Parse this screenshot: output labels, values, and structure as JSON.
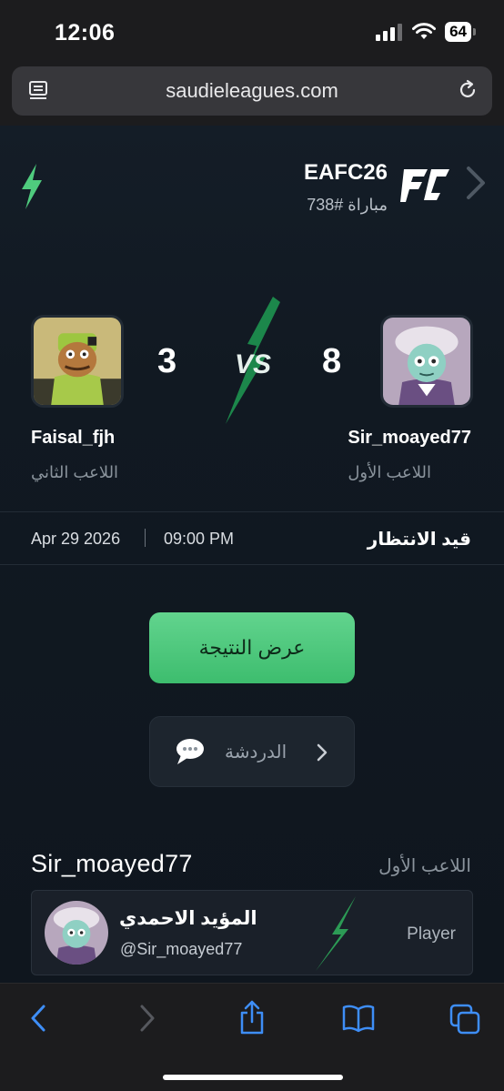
{
  "status_bar": {
    "time": "12:06",
    "battery": "64"
  },
  "browser": {
    "url": "saudieleagues.com"
  },
  "match": {
    "game": "EAFC26",
    "match_label": "مباراة #738",
    "player_one": {
      "name": "Sir_moayed77",
      "role": "اللاعب الأول",
      "score": "8"
    },
    "player_two": {
      "name": "Faisal_fjh",
      "role": "اللاعب الثاني",
      "score": "3"
    },
    "vs_label": "VS",
    "date": "Apr 29 2026",
    "time": "09:00 PM",
    "status": "قيد الانتظار"
  },
  "actions": {
    "view_result": "عرض النتيجة",
    "chat": "الدردشة"
  },
  "player_section": {
    "username": "Sir_moayed77",
    "role": "اللاعب الأول",
    "display_name": "المؤيد الاحمدي",
    "handle": "@Sir_moayed77",
    "type": "Player"
  },
  "colors": {
    "accent_green": "#4fcb7e",
    "background": "#0e141b"
  },
  "toolbar": {
    "icons": [
      "back-icon",
      "forward-icon",
      "share-icon",
      "bookmarks-icon",
      "tabs-icon"
    ]
  }
}
